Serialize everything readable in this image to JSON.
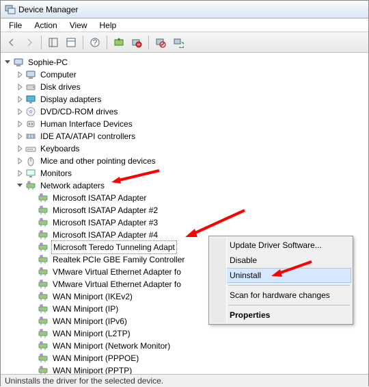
{
  "title": "Device Manager",
  "menubar": {
    "file": "File",
    "action": "Action",
    "view": "View",
    "help": "Help"
  },
  "status": "Uninstalls the driver for the selected device.",
  "root": "Sophie-PC",
  "categories": {
    "computer": "Computer",
    "disk": "Disk drives",
    "display": "Display adapters",
    "dvd": "DVD/CD-ROM drives",
    "hid": "Human Interface Devices",
    "ide": "IDE ATA/ATAPI controllers",
    "keyboards": "Keyboards",
    "mice": "Mice and other pointing devices",
    "monitors": "Monitors",
    "network": "Network adapters"
  },
  "network_items": [
    "Microsoft ISATAP Adapter",
    "Microsoft ISATAP Adapter #2",
    "Microsoft ISATAP Adapter #3",
    "Microsoft ISATAP Adapter #4",
    "Microsoft Teredo Tunneling Adapt",
    "Realtek PCIe GBE Family Controller",
    "VMware Virtual Ethernet Adapter fo",
    "VMware Virtual Ethernet Adapter fo",
    "WAN Miniport (IKEv2)",
    "WAN Miniport (IP)",
    "WAN Miniport (IPv6)",
    "WAN Miniport (L2TP)",
    "WAN Miniport (Network Monitor)",
    "WAN Miniport (PPPOE)",
    "WAN Miniport (PPTP)"
  ],
  "context_menu": {
    "update": "Update Driver Software...",
    "disable": "Disable",
    "uninstall": "Uninstall",
    "scan": "Scan for hardware changes",
    "properties": "Properties"
  }
}
